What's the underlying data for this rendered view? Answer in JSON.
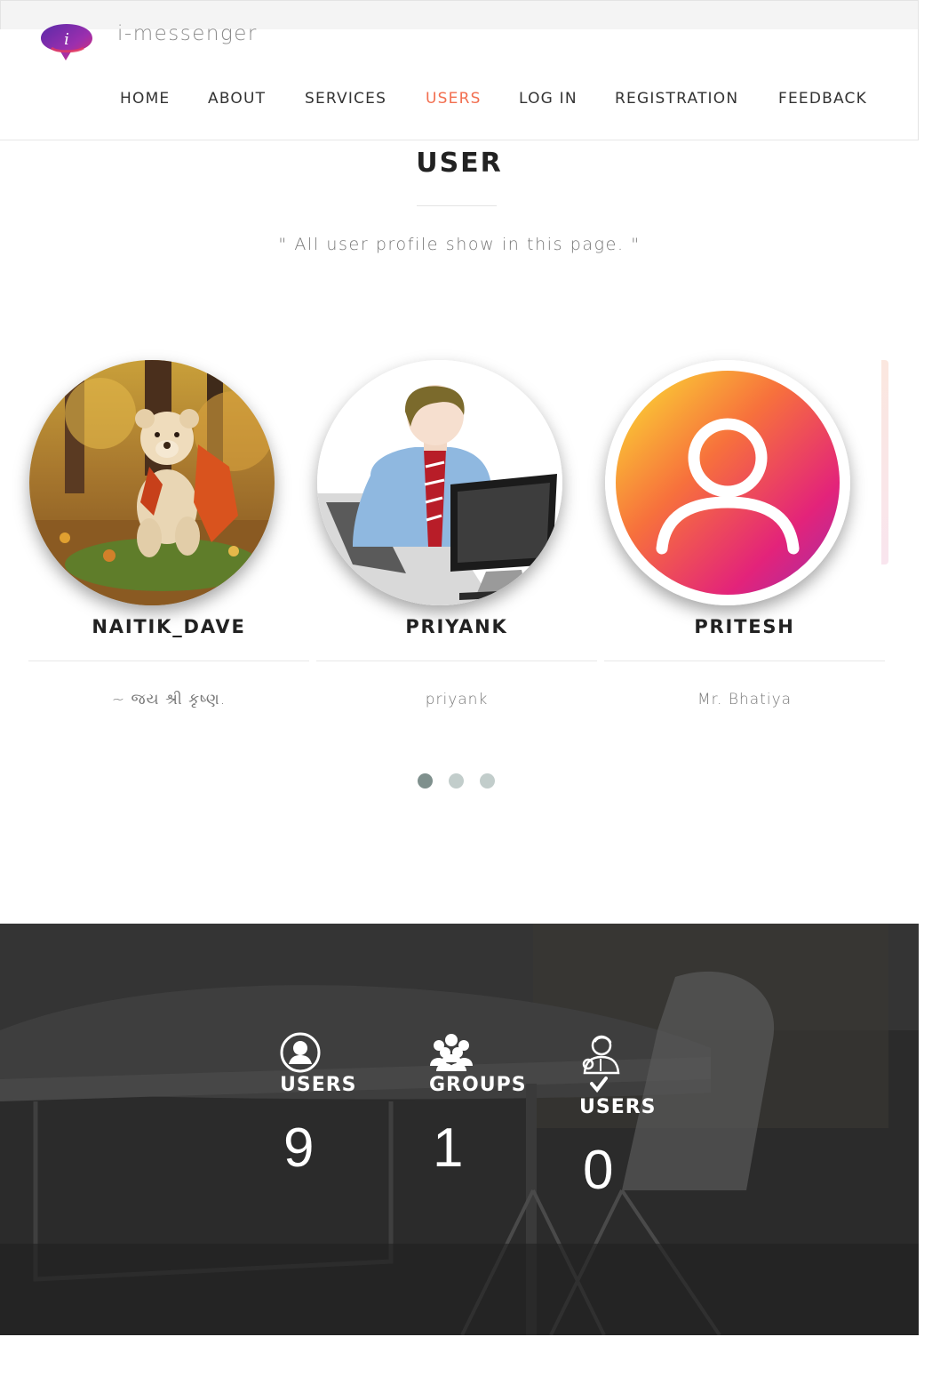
{
  "header": {
    "brand": "i-messenger",
    "nav": [
      {
        "label": "HOME",
        "active": false
      },
      {
        "label": "ABOUT",
        "active": false
      },
      {
        "label": "SERVICES",
        "active": false
      },
      {
        "label": "USERS",
        "active": true
      },
      {
        "label": "LOG IN",
        "active": false
      },
      {
        "label": "REGISTRATION",
        "active": false
      },
      {
        "label": "FEEDBACK",
        "active": false
      }
    ]
  },
  "section": {
    "title": "USER",
    "subtitle": "\" All user profile show in this page. \""
  },
  "users": [
    {
      "name": "NAITIK_DAVE",
      "status": "~ જય શ્રી કૃષ્ણ.",
      "avatar": "teddy-bear-autumn-photo"
    },
    {
      "name": "PRIYANK",
      "status": "priyank",
      "avatar": "man-at-computer-illustration"
    },
    {
      "name": "PRITESH",
      "status": "Mr. Bhatiya",
      "avatar": "default-user-gradient-icon"
    }
  ],
  "carousel": {
    "pages": 3,
    "active_page": 1
  },
  "stats": [
    {
      "icon": "user-circle-icon",
      "label": "USERS",
      "value": "9"
    },
    {
      "icon": "group-icon",
      "label": "GROUPS",
      "value": "1"
    },
    {
      "icon": "verified-user-icon",
      "label": "USERS",
      "value": "0"
    }
  ],
  "colors": {
    "accent": "#f26e4f",
    "dark_band": "#2a2a2a",
    "dot_active": "#7f908d",
    "dot_inactive": "#c2cdcb"
  }
}
